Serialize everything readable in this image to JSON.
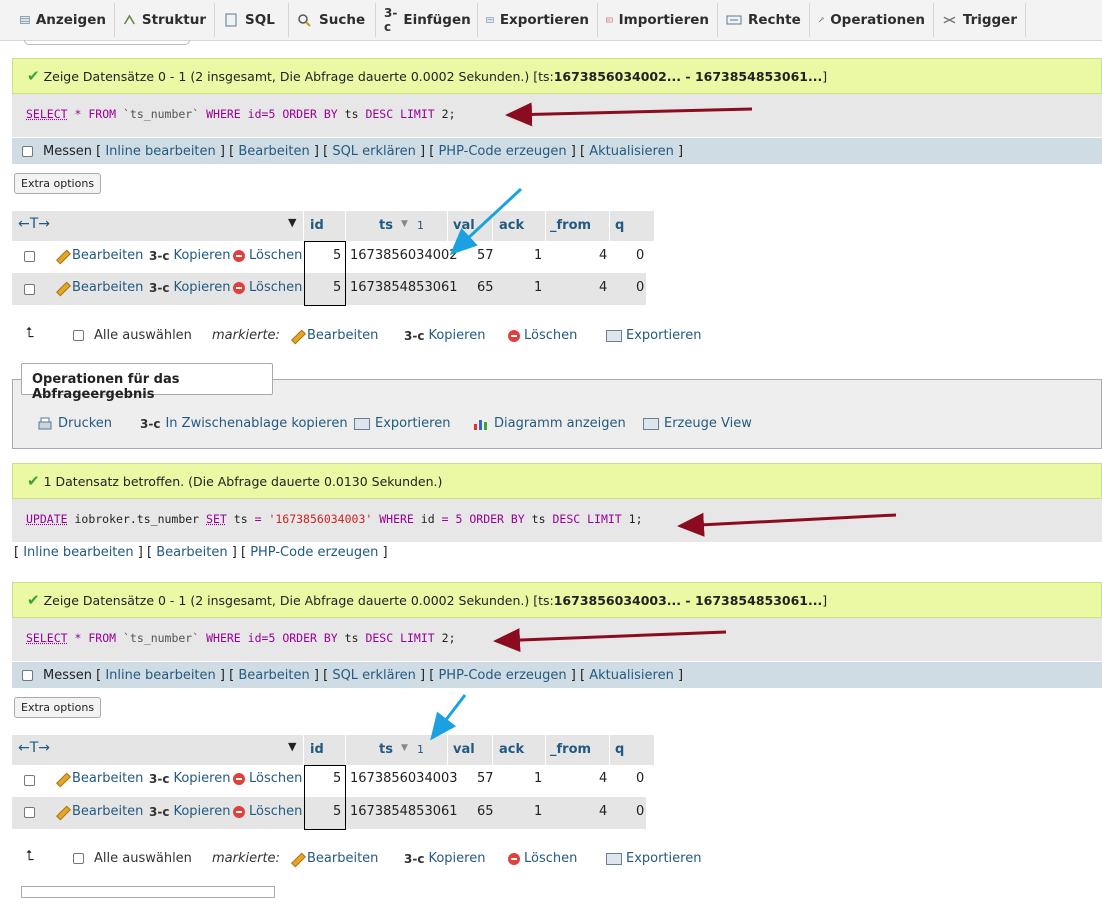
{
  "tabs": [
    {
      "label": "Anzeigen",
      "icon": "browse-icon"
    },
    {
      "label": "Struktur",
      "icon": "structure-icon"
    },
    {
      "label": "SQL",
      "icon": "sql-icon"
    },
    {
      "label": "Suche",
      "icon": "search-icon"
    },
    {
      "label": "Einfügen",
      "icon": "insert-icon"
    },
    {
      "label": "Exportieren",
      "icon": "export-icon"
    },
    {
      "label": "Importieren",
      "icon": "import-icon"
    },
    {
      "label": "Rechte",
      "icon": "privileges-icon"
    },
    {
      "label": "Operationen",
      "icon": "wrench-icon"
    },
    {
      "label": "Trigger",
      "icon": "trigger-icon"
    }
  ],
  "query1": {
    "message": "Zeige Datensätze 0 - 1 (2 insgesamt, Die Abfrage dauerte 0.0002 Sekunden.) [ts: ",
    "range": "1673856034002... - 1673854853061...",
    "range_close": "]",
    "sql": {
      "select": "SELECT",
      "star": "*",
      "from": "FROM",
      "table": "`ts_number`",
      "where": "WHERE",
      "cond": "id=5",
      "order": "ORDER BY",
      "col": "ts",
      "desc": "DESC",
      "limit": "LIMIT",
      "n": "2;"
    },
    "rows": [
      {
        "id": "5",
        "ts": "1673856034002",
        "val": "57",
        "ack": "1",
        "from": "4",
        "q": "0"
      },
      {
        "id": "5",
        "ts": "1673854853061",
        "val": "65",
        "ack": "1",
        "from": "4",
        "q": "0"
      }
    ]
  },
  "update": {
    "message": "1 Datensatz betroffen. (Die Abfrage dauerte 0.0130 Sekunden.)",
    "sql": {
      "update": "UPDATE",
      "table": "iobroker.ts_number",
      "set": "SET",
      "col": "ts",
      "eq": "=",
      "value": "'1673856034003'",
      "where": "WHERE",
      "cond": "id",
      "eq2": "=",
      "n5": "5",
      "order": "ORDER BY",
      "col2": "ts",
      "desc": "DESC",
      "limit": "LIMIT",
      "n": "1;"
    },
    "links": [
      "Inline bearbeiten",
      "Bearbeiten",
      "PHP-Code erzeugen"
    ]
  },
  "query2": {
    "message": "Zeige Datensätze 0 - 1 (2 insgesamt, Die Abfrage dauerte 0.0002 Sekunden.) [ts: ",
    "range": "1673856034003... - 1673854853061...",
    "range_close": "]",
    "rows": [
      {
        "id": "5",
        "ts": "1673856034003",
        "val": "57",
        "ack": "1",
        "from": "4",
        "q": "0"
      },
      {
        "id": "5",
        "ts": "1673854853061",
        "val": "65",
        "ack": "1",
        "from": "4",
        "q": "0"
      }
    ]
  },
  "querybar": {
    "messen": "Messen",
    "links": [
      "Inline bearbeiten",
      "Bearbeiten",
      "SQL erklären",
      "PHP-Code erzeugen",
      "Aktualisieren"
    ]
  },
  "extra_options": "Extra options",
  "columns": {
    "id": "id",
    "ts": "ts",
    "ts_sort": "1",
    "val": "val",
    "ack": "ack",
    "from": "_from",
    "q": "q"
  },
  "row_actions": {
    "edit": "Bearbeiten",
    "copy": "Kopieren",
    "delete": "Löschen"
  },
  "bulk": {
    "select_all": "Alle auswählen",
    "marked": "markierte:",
    "edit": "Bearbeiten",
    "copy": "Kopieren",
    "delete": "Löschen",
    "export": "Exportieren"
  },
  "operations": {
    "legend": "Operationen für das Abfrageergebnis",
    "items": [
      "Drucken",
      "In Zwischenablage kopieren",
      "Exportieren",
      "Diagramm anzeigen",
      "Erzeuge View"
    ]
  },
  "colors": {
    "success_bg": "#ebf8a4",
    "link": "#235a81",
    "arrow_red": "#8b0c1e",
    "arrow_blue": "#1ba1e2"
  }
}
